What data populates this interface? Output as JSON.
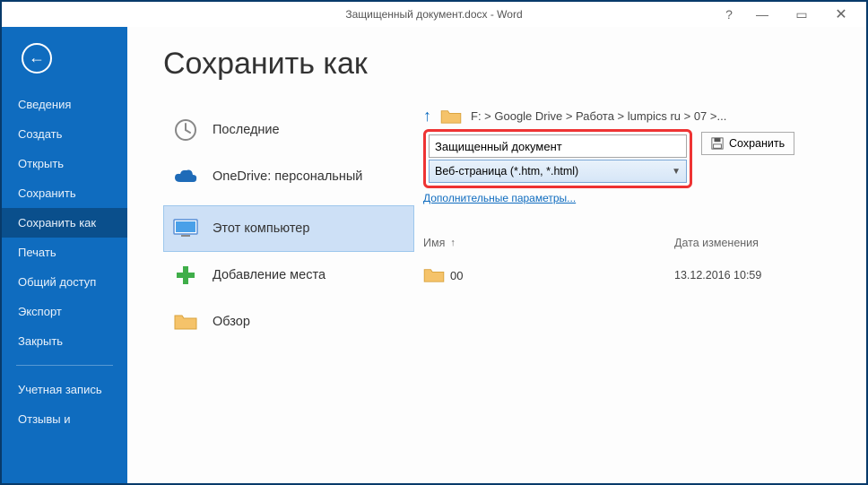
{
  "titlebar": {
    "title": "Защищенный документ.docx - Word",
    "help": "?",
    "minimize": "—",
    "restore": "▭",
    "close": "✕"
  },
  "sidebar": {
    "items": [
      "Сведения",
      "Создать",
      "Открыть",
      "Сохранить",
      "Сохранить как",
      "Печать",
      "Общий доступ",
      "Экспорт",
      "Закрыть"
    ],
    "lower": [
      "Учетная запись",
      "Отзывы и"
    ],
    "selected_index": 4
  },
  "page": {
    "title": "Сохранить как"
  },
  "locations": {
    "items": [
      {
        "label": "Последние",
        "icon": "clock-icon"
      },
      {
        "label": "OneDrive: персональный",
        "icon": "cloud-icon",
        "sub": " "
      },
      {
        "label": "Этот компьютер",
        "icon": "monitor-icon"
      },
      {
        "label": "Добавление места",
        "icon": "plus-icon"
      },
      {
        "label": "Обзор",
        "icon": "folder-icon"
      }
    ],
    "selected_index": 2
  },
  "right": {
    "breadcrumb": "F: > Google Drive > Работа > lumpics ru > 07 >...",
    "filename": "Защищенный документ",
    "filetype": "Веб-страница (*.htm, *.html)",
    "save_label": "Сохранить",
    "more_link": "Дополнительные параметры...",
    "columns": {
      "name": "Имя",
      "date": "Дата изменения"
    },
    "rows": [
      {
        "name": "00",
        "date": "13.12.2016 10:59"
      }
    ]
  }
}
